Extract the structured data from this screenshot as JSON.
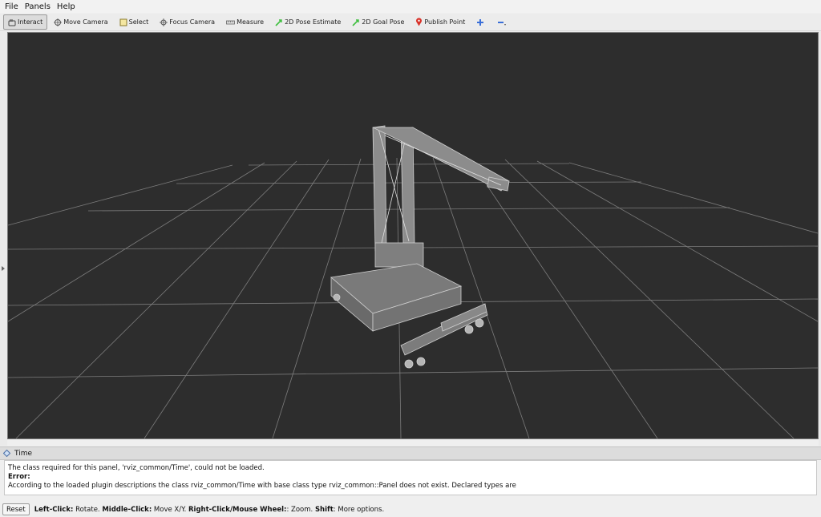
{
  "menu": {
    "file": "File",
    "panels": "Panels",
    "help": "Help"
  },
  "toolbar": {
    "interact": "Interact",
    "move_camera": "Move Camera",
    "select": "Select",
    "focus_camera": "Focus Camera",
    "measure": "Measure",
    "pose_estimate": "2D Pose Estimate",
    "goal_pose": "2D Goal Pose",
    "publish_point": "Publish Point"
  },
  "time_panel": {
    "title": "Time",
    "line1": "The class required for this panel, 'rviz_common/Time', could not be loaded.",
    "error_label": "Error:",
    "line3": "According to the loaded plugin descriptions the class rviz_common/Time with base class type rviz_common::Panel does not exist. Declared types are"
  },
  "status": {
    "reset": "Reset",
    "k1": "Left-Click:",
    "v1": " Rotate. ",
    "k2": "Middle-Click:",
    "v2": " Move X/Y. ",
    "k3": "Right-Click/Mouse Wheel:",
    "v3": ": Zoom. ",
    "k4": "Shift",
    "v4": ": More options."
  },
  "colors": {
    "viewport_bg": "#2d2d2d",
    "grid_line": "#9a9a9a",
    "robot_fill": "#8a8a8a",
    "pose_arrow": "#3fbf3f",
    "publish_point": "#d9342b",
    "plus_icon": "#3a6fd8"
  }
}
